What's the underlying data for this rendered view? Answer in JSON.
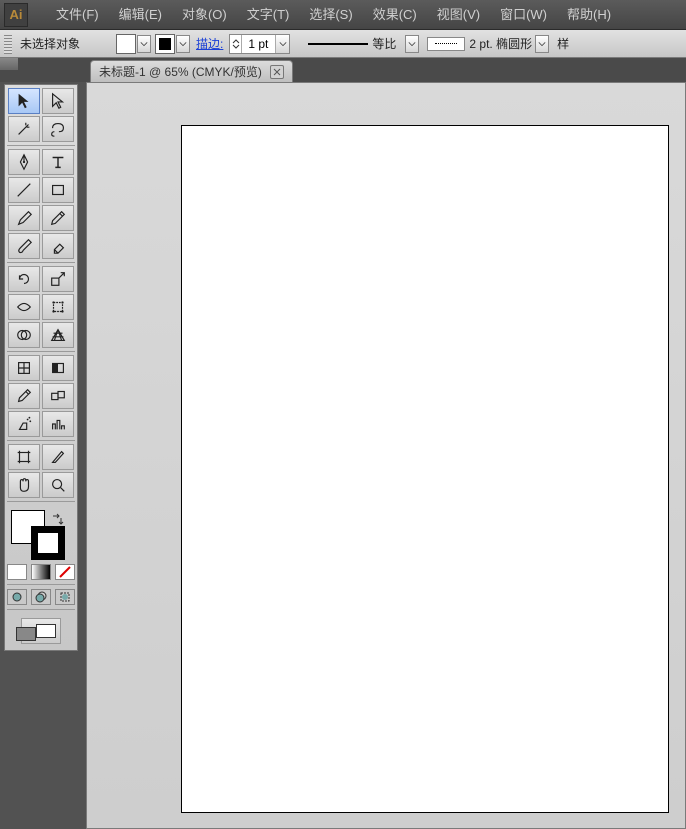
{
  "app_icon_text": "Ai",
  "menu": {
    "file": "文件(F)",
    "edit": "编辑(E)",
    "object": "对象(O)",
    "type": "文字(T)",
    "select": "选择(S)",
    "effect": "效果(C)",
    "view": "视图(V)",
    "window": "窗口(W)",
    "help": "帮助(H)"
  },
  "options": {
    "no_selection": "未选择对象",
    "stroke_label": "描边:",
    "stroke_value": "1 pt",
    "scale_label": "等比",
    "brush_value": "2 pt. 椭圆形",
    "style_label": "样"
  },
  "doc_tab": {
    "title": "未标题-1 @ 65% (CMYK/预览)"
  },
  "tools": {
    "names": [
      "selection-tool",
      "direct-selection-tool",
      "magic-wand-tool",
      "lasso-tool",
      "pen-tool",
      "type-tool",
      "line-segment-tool",
      "rectangle-tool",
      "paintbrush-tool",
      "pencil-tool",
      "blob-brush-tool",
      "eraser-tool",
      "rotate-tool",
      "scale-tool",
      "width-tool",
      "free-transform-tool",
      "shape-builder-tool",
      "perspective-grid-tool",
      "mesh-tool",
      "gradient-tool",
      "eyedropper-tool",
      "blend-tool",
      "symbol-sprayer-tool",
      "column-graph-tool",
      "artboard-tool",
      "slice-tool",
      "hand-tool",
      "zoom-tool"
    ]
  },
  "fill_stroke": {
    "fill_color": "#ffffff",
    "stroke_color": "#000000"
  },
  "color_modes": {
    "solid": "solid",
    "gradient": "gradient",
    "none": "none"
  },
  "draw_modes": {
    "normal": "draw-normal",
    "behind": "draw-behind",
    "inside": "draw-inside"
  }
}
